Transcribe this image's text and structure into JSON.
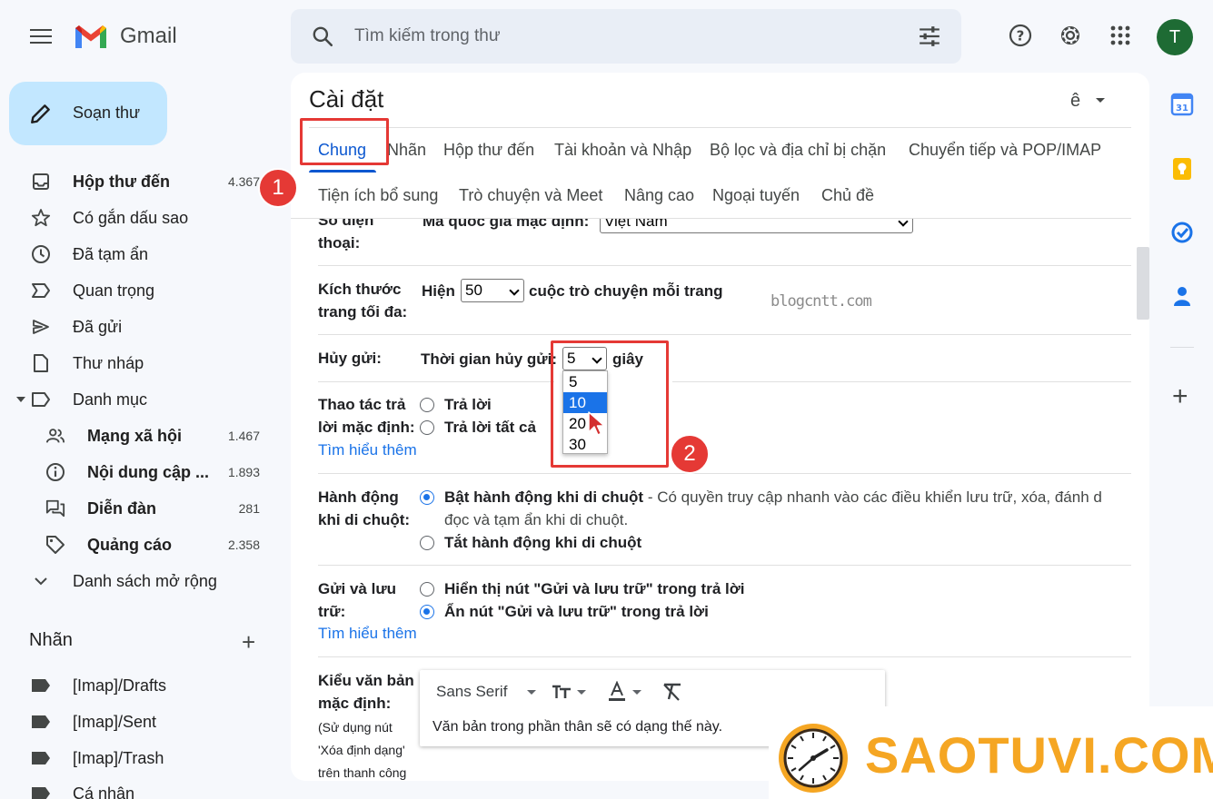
{
  "app": {
    "name": "Gmail"
  },
  "search": {
    "placeholder": "Tìm kiếm trong thư"
  },
  "user": {
    "initial": "T"
  },
  "sidebar": {
    "compose_label": "Soạn thư",
    "items": [
      {
        "label": "Hộp thư đến",
        "count": "4.367"
      },
      {
        "label": "Có gắn dấu sao"
      },
      {
        "label": "Đã tạm ẩn"
      },
      {
        "label": "Quan trọng"
      },
      {
        "label": "Đã gửi"
      },
      {
        "label": "Thư nháp"
      },
      {
        "label": "Danh mục"
      }
    ],
    "categories": [
      {
        "label": "Mạng xã hội",
        "count": "1.467"
      },
      {
        "label": "Nội dung cập ...",
        "count": "1.893"
      },
      {
        "label": "Diễn đàn",
        "count": "281"
      },
      {
        "label": "Quảng cáo",
        "count": "2.358"
      }
    ],
    "more_label": "Danh sách mở rộng",
    "labels_heading": "Nhãn",
    "labels": [
      "[Imap]/Drafts",
      "[Imap]/Sent",
      "[Imap]/Trash",
      "Cá nhân"
    ]
  },
  "settings": {
    "title": "Cài đặt",
    "lang_glyph": "ê",
    "tabs_row1": [
      "Chung",
      "Nhãn",
      "Hộp thư đến",
      "Tài khoản và Nhập",
      "Bộ lọc và địa chỉ bị chặn",
      "Chuyển tiếp và POP/IMAP"
    ],
    "tabs_row2": [
      "Tiện ích bổ sung",
      "Trò chuyện và Meet",
      "Nâng cao",
      "Ngoại tuyến",
      "Chủ đề"
    ],
    "phone": {
      "label_1": "Số điện",
      "label_2": "thoại:",
      "text": "Mã quốc gia mặc định:",
      "value": "Việt Nam"
    },
    "page_size": {
      "label_1": "Kích thước",
      "label_2": "trang tối đa:",
      "prefix": "Hiện",
      "value": "50",
      "suffix": "cuộc trò chuyện mỗi trang"
    },
    "undo_send": {
      "label": "Hủy gửi:",
      "text": "Thời gian hủy gửi:",
      "value": "5",
      "suffix": "giây",
      "options": [
        "5",
        "10",
        "20",
        "30"
      ]
    },
    "reply": {
      "label_1": "Thao tác trả",
      "label_2": "lời mặc định:",
      "opt1": "Trả lời",
      "opt2": "Trả lời tất cả",
      "learn_more": "Tìm hiểu thêm"
    },
    "hover": {
      "label_1": "Hành động",
      "label_2": "khi di chuột:",
      "opt1_bold": "Bật hành động khi di chuột",
      "opt1_rest": " - Có quyền truy cập nhanh vào các điều khiển lưu trữ, xóa, đánh d",
      "opt1_line2": "đọc và tạm ẩn khi di chuột.",
      "opt2": "Tắt hành động khi di chuột"
    },
    "send_archive": {
      "label_1": "Gửi và lưu",
      "label_2": "trữ:",
      "opt1": "Hiển thị nút \"Gửi và lưu trữ\" trong trả lời",
      "opt2": "Ẩn nút \"Gửi và lưu trữ\" trong trả lời",
      "learn_more": "Tìm hiểu thêm"
    },
    "text_style": {
      "label_1": "Kiểu văn bản",
      "label_2": "mặc định:",
      "note_1": "(Sử dụng nút",
      "note_2": "'Xóa định dạng'",
      "note_3": "trên thanh công",
      "font": "Sans Serif",
      "preview": "Văn bản trong phần thân sẽ có dạng thế này."
    }
  },
  "annotations": {
    "badge1": "1",
    "badge2": "2"
  },
  "watermark": "blogcntt.com",
  "brand": "SAOTUVI.COM",
  "colors": {
    "accent": "#0b57d0",
    "compose_bg": "#c2e7ff",
    "annotation": "#e53935",
    "brand": "#f5a623"
  }
}
